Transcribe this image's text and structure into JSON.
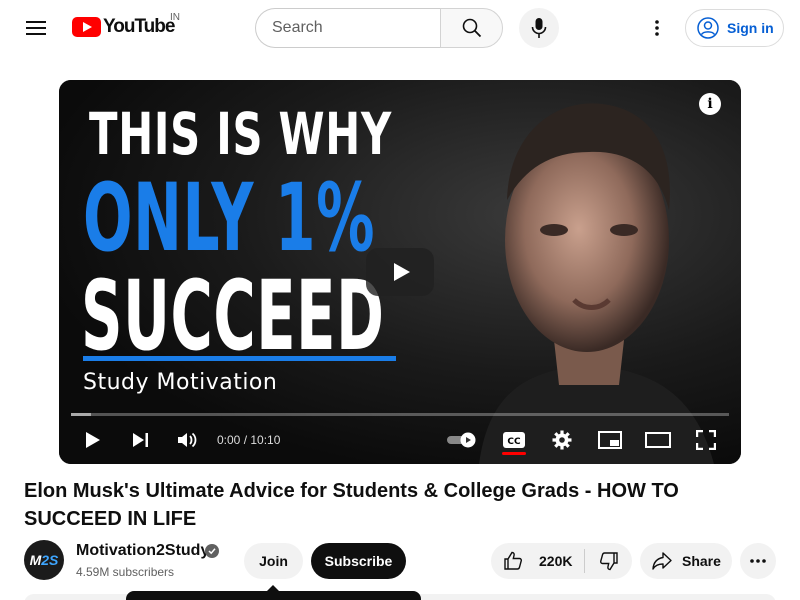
{
  "header": {
    "logo_text": "YouTube",
    "country_code": "IN",
    "search_placeholder": "Search",
    "signin_label": "Sign in"
  },
  "player": {
    "thumbnail": {
      "line1": "THIS IS WHY",
      "line2": "ONLY 1%",
      "line3": "SUCCEED",
      "subtitle": "Study Motivation"
    },
    "info_label": "i",
    "time_display": "0:00 / 10:10",
    "progress_fraction": 0.03,
    "captions_on": true
  },
  "video": {
    "title": "Elon Musk's Ultimate Advice for Students & College Grads - HOW TO SUCCEED IN LIFE"
  },
  "owner": {
    "avatar_text_a": "M",
    "avatar_text_b": "2S",
    "channel_name": "Motivation2Study",
    "verified": true,
    "subscribers": "4.59M subscribers",
    "join_label": "Join",
    "subscribe_label": "Subscribe"
  },
  "actions": {
    "like_count": "220K",
    "share_label": "Share"
  },
  "colors": {
    "brand_red": "#ff0000",
    "link_blue": "#065fd4",
    "thumb_blue": "#1a7de8"
  }
}
